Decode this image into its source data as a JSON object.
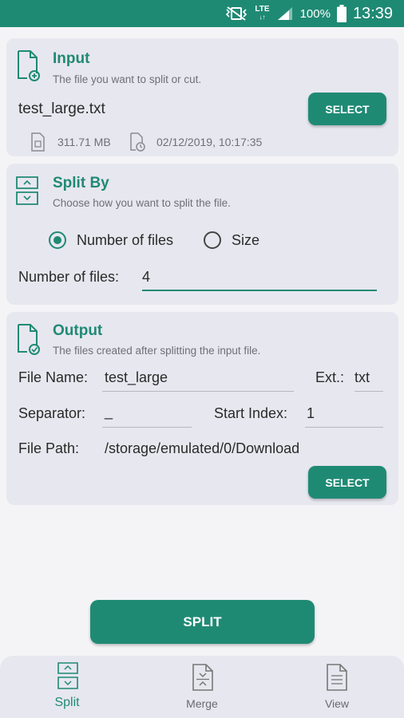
{
  "status_bar": {
    "network": "LTE",
    "battery": "100%",
    "time": "13:39"
  },
  "input_card": {
    "title": "Input",
    "subtitle": "The file you want to split or cut.",
    "filename": "test_large.txt",
    "select_label": "SELECT",
    "size": "311.71 MB",
    "modified": "02/12/2019, 10:17:35"
  },
  "split_card": {
    "title": "Split By",
    "subtitle": "Choose how you want to split the file.",
    "options": [
      "Number of files",
      "Size"
    ],
    "selected_option": "Number of files",
    "count_label": "Number of files:",
    "count_value": "4"
  },
  "output_card": {
    "title": "Output",
    "subtitle": "The files created after splitting the input file.",
    "file_name_label": "File Name:",
    "file_name_value": "test_large",
    "ext_label": "Ext.:",
    "ext_value": "txt",
    "separator_label": "Separator:",
    "separator_value": "_",
    "start_index_label": "Start Index:",
    "start_index_value": "1",
    "file_path_label": "File Path:",
    "file_path_value": "/storage/emulated/0/Download",
    "select_label": "SELECT"
  },
  "split_button": "SPLIT",
  "bottom_nav": {
    "items": [
      {
        "label": "Split",
        "icon": "split-file-icon",
        "active": true
      },
      {
        "label": "Merge",
        "icon": "merge-file-icon",
        "active": false
      },
      {
        "label": "View",
        "icon": "view-file-icon",
        "active": false
      }
    ]
  },
  "colors": {
    "accent": "#1f8a74",
    "card": "#e7e7ef",
    "background": "#f4f4f6"
  }
}
